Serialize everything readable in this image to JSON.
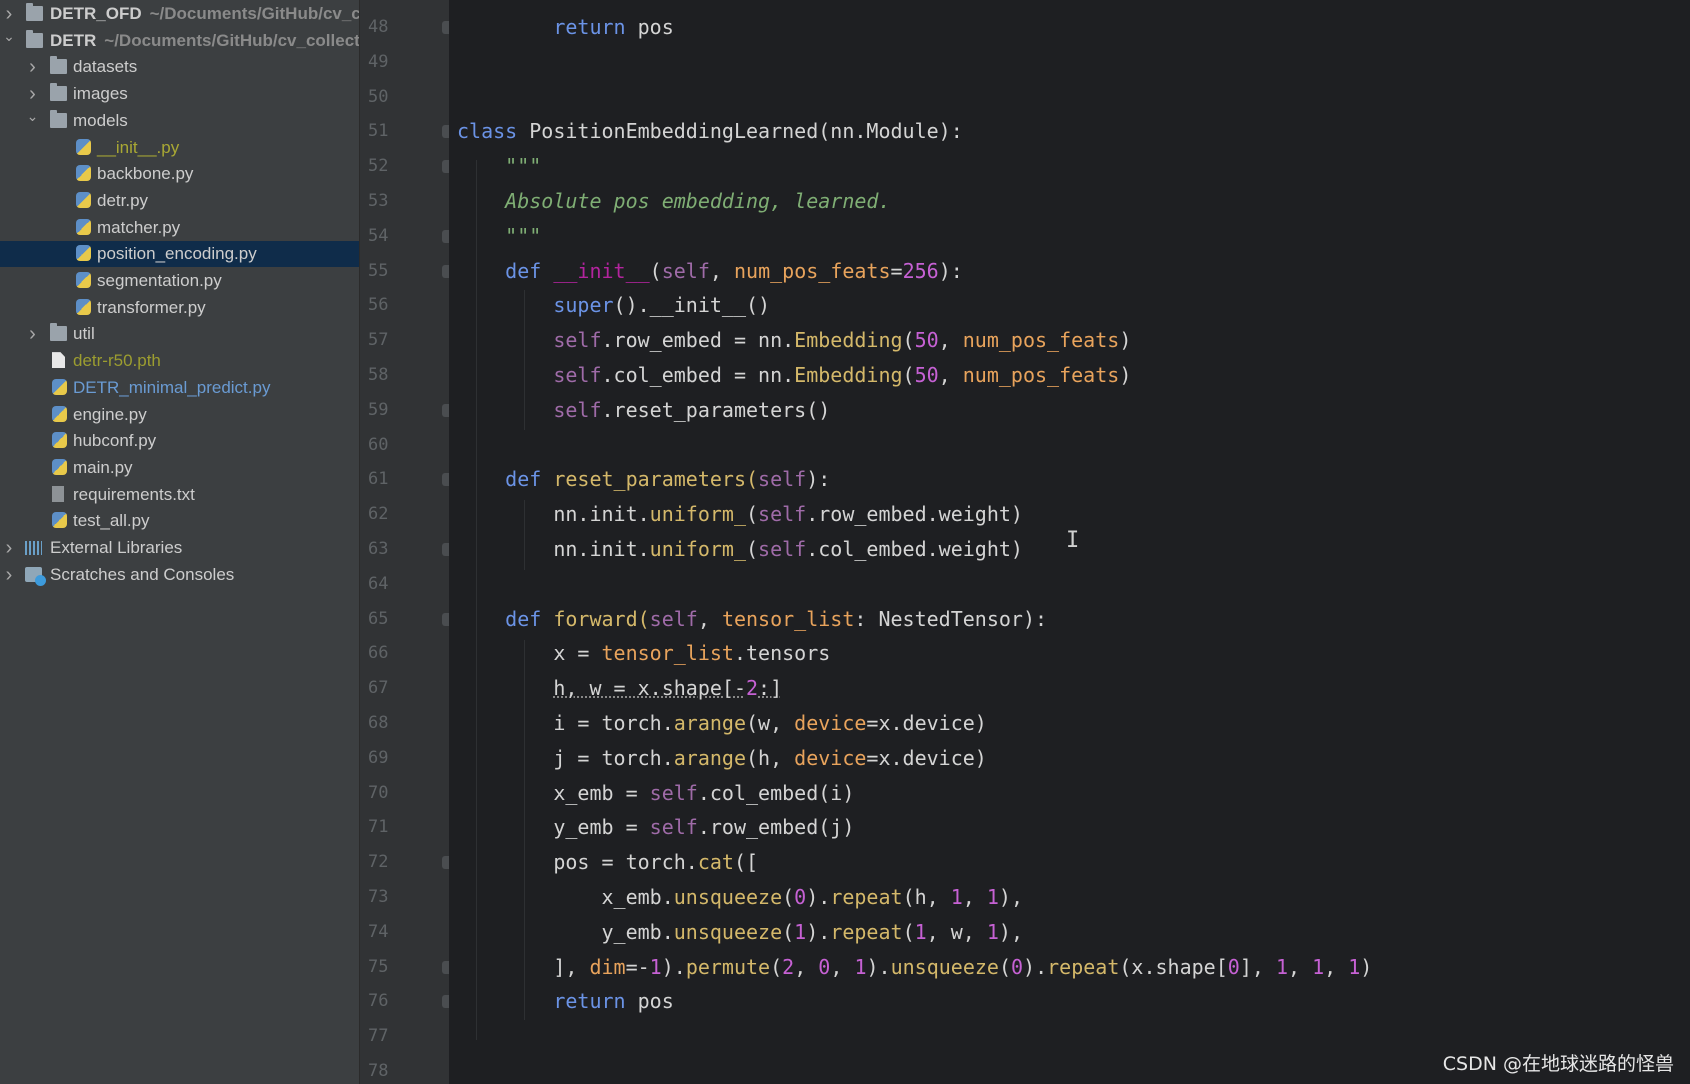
{
  "project_tree": [
    {
      "label": "DETR_OFD",
      "path": "~/Documents/GitHub/cv_c",
      "level": 0,
      "kind": "folder",
      "chevron": "right",
      "bold": true
    },
    {
      "label": "DETR",
      "path": "~/Documents/GitHub/cv_collect",
      "level": 0,
      "kind": "folder",
      "chevron": "down",
      "bold": true
    },
    {
      "label": "datasets",
      "level": 1,
      "kind": "folder",
      "chevron": "right"
    },
    {
      "label": "images",
      "level": 1,
      "kind": "folder",
      "chevron": "right"
    },
    {
      "label": "models",
      "level": 1,
      "kind": "folder",
      "chevron": "down"
    },
    {
      "label": "__init__.py",
      "level": 2,
      "kind": "py",
      "color": "#a9a834"
    },
    {
      "label": "backbone.py",
      "level": 2,
      "kind": "py"
    },
    {
      "label": "detr.py",
      "level": 2,
      "kind": "py"
    },
    {
      "label": "matcher.py",
      "level": 2,
      "kind": "py"
    },
    {
      "label": "position_encoding.py",
      "level": 2,
      "kind": "py",
      "selected": true
    },
    {
      "label": "segmentation.py",
      "level": 2,
      "kind": "py"
    },
    {
      "label": "transformer.py",
      "level": 2,
      "kind": "py"
    },
    {
      "label": "util",
      "level": 1,
      "kind": "folder",
      "chevron": "right"
    },
    {
      "label": "detr-r50.pth",
      "level": 1,
      "kind": "doc",
      "color": "#9c9d30"
    },
    {
      "label": "DETR_minimal_predict.py",
      "level": 1,
      "kind": "py",
      "color": "#6a9bd3"
    },
    {
      "label": "engine.py",
      "level": 1,
      "kind": "py"
    },
    {
      "label": "hubconf.py",
      "level": 1,
      "kind": "py"
    },
    {
      "label": "main.py",
      "level": 1,
      "kind": "py"
    },
    {
      "label": "requirements.txt",
      "level": 1,
      "kind": "txt"
    },
    {
      "label": "test_all.py",
      "level": 1,
      "kind": "py"
    },
    {
      "label": "External Libraries",
      "level": 0,
      "kind": "lib",
      "chevron": "right"
    },
    {
      "label": "Scratches and Consoles",
      "level": 0,
      "kind": "scratch",
      "chevron": "right"
    }
  ],
  "editor": {
    "first_line": 48,
    "fold_lines": [
      48,
      51,
      52,
      54,
      55,
      59,
      61,
      63,
      65,
      72,
      75,
      76
    ],
    "lines": [
      [
        [
          "        ",
          "plain"
        ],
        [
          "return",
          "kw"
        ],
        [
          " pos",
          "plain"
        ]
      ],
      [],
      [],
      [
        [
          "class",
          "kw"
        ],
        [
          " PositionEmbeddingLearned(nn.Module):",
          "plain"
        ]
      ],
      [
        [
          "    ",
          "plain"
        ],
        [
          "\"\"\"",
          "doc"
        ]
      ],
      [
        [
          "    ",
          "plain"
        ],
        [
          "Absolute pos embedding, learned.",
          "doc"
        ]
      ],
      [
        [
          "    ",
          "plain"
        ],
        [
          "\"\"\"",
          "doc"
        ]
      ],
      [
        [
          "    ",
          "plain"
        ],
        [
          "def",
          "kw"
        ],
        [
          " ",
          "plain"
        ],
        [
          "__init__",
          "magic"
        ],
        [
          "(",
          "plain"
        ],
        [
          "self",
          "self"
        ],
        [
          ", ",
          "plain"
        ],
        [
          "num_pos_feats",
          "param"
        ],
        [
          "=",
          "plain"
        ],
        [
          "256",
          "num"
        ],
        [
          "):",
          "plain"
        ]
      ],
      [
        [
          "        ",
          "plain"
        ],
        [
          "super",
          "kw"
        ],
        [
          "().__init__()",
          "plain"
        ]
      ],
      [
        [
          "        ",
          "plain"
        ],
        [
          "self",
          "self"
        ],
        [
          ".row_embed = nn.",
          "plain"
        ],
        [
          "Embedding",
          "fn"
        ],
        [
          "(",
          "plain"
        ],
        [
          "50",
          "num"
        ],
        [
          ", ",
          "plain"
        ],
        [
          "num_pos_feats",
          "param"
        ],
        [
          ")",
          "plain"
        ]
      ],
      [
        [
          "        ",
          "plain"
        ],
        [
          "self",
          "self"
        ],
        [
          ".col_embed = nn.",
          "plain"
        ],
        [
          "Embedding",
          "fn"
        ],
        [
          "(",
          "plain"
        ],
        [
          "50",
          "num"
        ],
        [
          ", ",
          "plain"
        ],
        [
          "num_pos_feats",
          "param"
        ],
        [
          ")",
          "plain"
        ]
      ],
      [
        [
          "        ",
          "plain"
        ],
        [
          "self",
          "self"
        ],
        [
          ".reset_parameters()",
          "plain"
        ]
      ],
      [],
      [
        [
          "    ",
          "plain"
        ],
        [
          "def",
          "kw"
        ],
        [
          " reset_parameters(",
          "fn"
        ],
        [
          "self",
          "self"
        ],
        [
          "):",
          "plain"
        ]
      ],
      [
        [
          "        ",
          "plain"
        ],
        [
          "nn.init.",
          "plain"
        ],
        [
          "uniform_",
          "fn"
        ],
        [
          "(",
          "plain"
        ],
        [
          "self",
          "self"
        ],
        [
          ".row_embed.weight)",
          "plain"
        ]
      ],
      [
        [
          "        ",
          "plain"
        ],
        [
          "nn.init.",
          "plain"
        ],
        [
          "uniform_",
          "fn"
        ],
        [
          "(",
          "plain"
        ],
        [
          "self",
          "self"
        ],
        [
          ".col_embed.weight)",
          "plain"
        ]
      ],
      [],
      [
        [
          "    ",
          "plain"
        ],
        [
          "def",
          "kw"
        ],
        [
          " forward(",
          "fn"
        ],
        [
          "self",
          "self"
        ],
        [
          ", ",
          "plain"
        ],
        [
          "tensor_list",
          "param"
        ],
        [
          ": NestedTensor):",
          "plain"
        ]
      ],
      [
        [
          "        ",
          "plain"
        ],
        [
          "x = ",
          "plain"
        ],
        [
          "tensor_list",
          "param"
        ],
        [
          ".tensors",
          "plain"
        ]
      ],
      [
        [
          "        ",
          "plain"
        ],
        [
          "h, w = x.shape[-",
          "under"
        ],
        [
          "2",
          "num"
        ],
        [
          ":]",
          "under"
        ]
      ],
      [
        [
          "        ",
          "plain"
        ],
        [
          "i = torch.",
          "plain"
        ],
        [
          "arange",
          "fn"
        ],
        [
          "(w, ",
          "plain"
        ],
        [
          "device",
          "param"
        ],
        [
          "=x.device)",
          "plain"
        ]
      ],
      [
        [
          "        ",
          "plain"
        ],
        [
          "j = torch.",
          "plain"
        ],
        [
          "arange",
          "fn"
        ],
        [
          "(h, ",
          "plain"
        ],
        [
          "device",
          "param"
        ],
        [
          "=x.device)",
          "plain"
        ]
      ],
      [
        [
          "        ",
          "plain"
        ],
        [
          "x_emb = ",
          "plain"
        ],
        [
          "self",
          "self"
        ],
        [
          ".col_embed(i)",
          "plain"
        ]
      ],
      [
        [
          "        ",
          "plain"
        ],
        [
          "y_emb = ",
          "plain"
        ],
        [
          "self",
          "self"
        ],
        [
          ".row_embed(j)",
          "plain"
        ]
      ],
      [
        [
          "        ",
          "plain"
        ],
        [
          "pos = torch.",
          "plain"
        ],
        [
          "cat",
          "fn"
        ],
        [
          "([",
          "plain"
        ]
      ],
      [
        [
          "            ",
          "plain"
        ],
        [
          "x_emb.",
          "plain"
        ],
        [
          "unsqueeze",
          "fn"
        ],
        [
          "(",
          "plain"
        ],
        [
          "0",
          "num"
        ],
        [
          ").",
          "plain"
        ],
        [
          "repeat",
          "fn"
        ],
        [
          "(h, ",
          "plain"
        ],
        [
          "1",
          "num"
        ],
        [
          ", ",
          "plain"
        ],
        [
          "1",
          "num"
        ],
        [
          "),",
          "plain"
        ]
      ],
      [
        [
          "            ",
          "plain"
        ],
        [
          "y_emb.",
          "plain"
        ],
        [
          "unsqueeze",
          "fn"
        ],
        [
          "(",
          "plain"
        ],
        [
          "1",
          "num"
        ],
        [
          ").",
          "plain"
        ],
        [
          "repeat",
          "fn"
        ],
        [
          "(",
          "plain"
        ],
        [
          "1",
          "num"
        ],
        [
          ", w, ",
          "plain"
        ],
        [
          "1",
          "num"
        ],
        [
          "),",
          "plain"
        ]
      ],
      [
        [
          "        ",
          "plain"
        ],
        [
          "], ",
          "plain"
        ],
        [
          "dim",
          "param"
        ],
        [
          "=-",
          "plain"
        ],
        [
          "1",
          "num"
        ],
        [
          ").",
          "plain"
        ],
        [
          "permute",
          "fn"
        ],
        [
          "(",
          "plain"
        ],
        [
          "2",
          "num"
        ],
        [
          ", ",
          "plain"
        ],
        [
          "0",
          "num"
        ],
        [
          ", ",
          "plain"
        ],
        [
          "1",
          "num"
        ],
        [
          ").",
          "plain"
        ],
        [
          "unsqueeze",
          "fn"
        ],
        [
          "(",
          "plain"
        ],
        [
          "0",
          "num"
        ],
        [
          ").",
          "plain"
        ],
        [
          "repeat",
          "fn"
        ],
        [
          "(x.shape[",
          "plain"
        ],
        [
          "0",
          "num"
        ],
        [
          "], ",
          "plain"
        ],
        [
          "1",
          "num"
        ],
        [
          ", ",
          "plain"
        ],
        [
          "1",
          "num"
        ],
        [
          ", ",
          "plain"
        ],
        [
          "1",
          "num"
        ],
        [
          ")",
          "plain"
        ]
      ],
      [
        [
          "        ",
          "plain"
        ],
        [
          "return",
          "kw"
        ],
        [
          " pos",
          "plain"
        ]
      ],
      [],
      []
    ]
  },
  "icons": {
    "cursor": "text-cursor-icon"
  },
  "watermark": "CSDN @在地球迷路的怪兽"
}
